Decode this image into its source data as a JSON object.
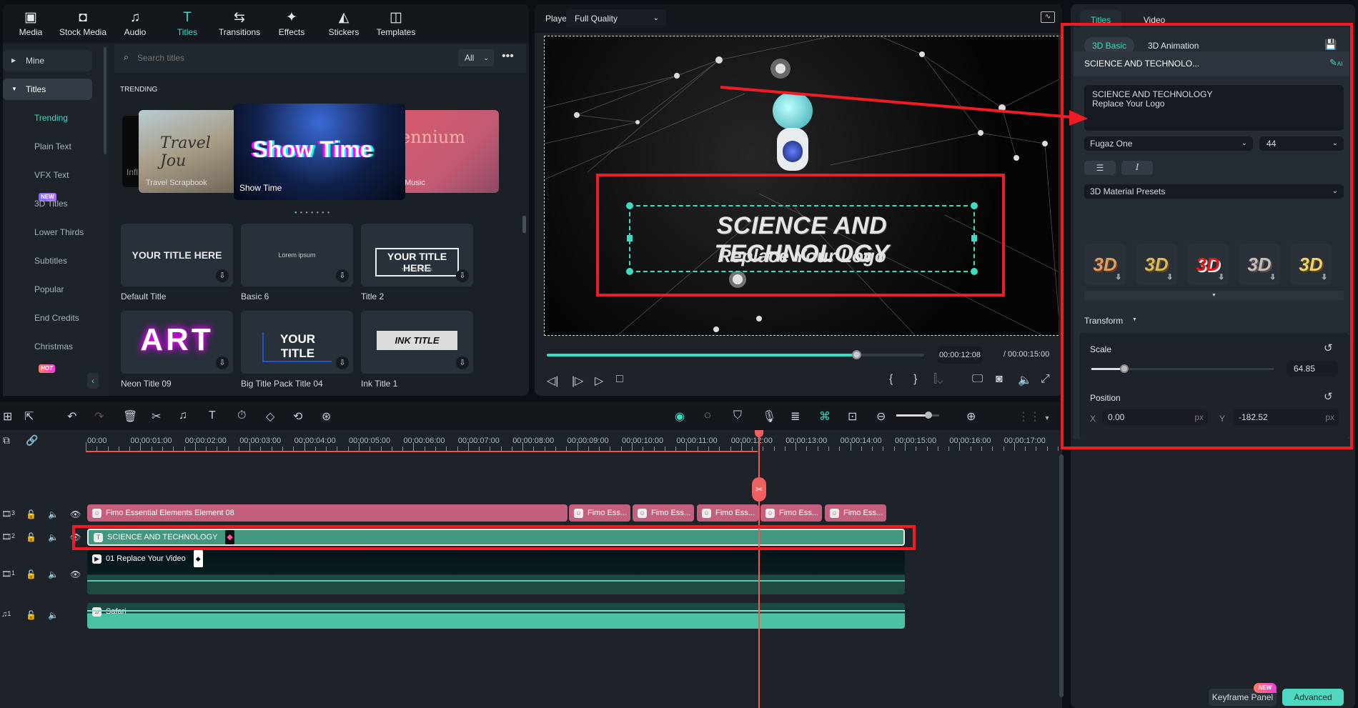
{
  "toolbar": {
    "items": [
      {
        "label": "Media",
        "icon": "media-icon"
      },
      {
        "label": "Stock Media",
        "icon": "stock-media-icon"
      },
      {
        "label": "Audio",
        "icon": "music-note-icon"
      },
      {
        "label": "Titles",
        "icon": "titles-icon"
      },
      {
        "label": "Transitions",
        "icon": "transitions-icon"
      },
      {
        "label": "Effects",
        "icon": "effects-icon"
      },
      {
        "label": "Stickers",
        "icon": "stickers-icon"
      },
      {
        "label": "Templates",
        "icon": "templates-icon"
      }
    ],
    "active": "Titles"
  },
  "sidebar": {
    "mine": "Mine",
    "titles": "Titles",
    "items": [
      "Trending",
      "Plain Text",
      "VFX Text",
      "3D Titles",
      "Lower Thirds",
      "Subtitles",
      "Popular",
      "End Credits",
      "Christmas"
    ],
    "badge_new": "NEW",
    "badge_hot": "HOT"
  },
  "library": {
    "search_placeholder": "Search titles",
    "filter": "All",
    "section": "TRENDING",
    "carousel": {
      "left": "Travel Scrapbook",
      "center": "Show Time",
      "center_art": "Show Time",
      "right": "Music",
      "right_art": "ennium",
      "left_art": "Travel Jou",
      "far_left": "Infl"
    },
    "cards": [
      {
        "label": "Default Title",
        "art": "YOUR TITLE HERE"
      },
      {
        "label": "Basic 6",
        "art": "Lorem ipsum"
      },
      {
        "label": "Title 2",
        "art": "YOUR TITLE HERE",
        "sub": "YOUR TEXT HERE"
      },
      {
        "label": "Neon Title 09",
        "art": "ART"
      },
      {
        "label": "Big Title Pack Title 04",
        "art": "YOUR TITLE"
      },
      {
        "label": "Ink Title 1",
        "art": "INK TITLE"
      }
    ]
  },
  "player": {
    "label": "Player",
    "quality": "Full Quality",
    "title_line1": "SCIENCE AND TECHNOLOGY",
    "title_line2": "Replace Your Logo",
    "current_time": "00:00:12:08",
    "total_time": "/ 00:00:15:00",
    "progress": 0.82
  },
  "timeline": {
    "ruler": [
      "00:00",
      "00:00:01:00",
      "00:00:02:00",
      "00:00:03:00",
      "00:00:04:00",
      "00:00:05:00",
      "00:00:06:00",
      "00:00:07:00",
      "00:00:08:00",
      "00:00:09:00",
      "00:00:10:00",
      "00:00:11:00",
      "00:00:12:00",
      "00:00:13:00",
      "00:00:14:00",
      "00:00:15:00",
      "00:00:16:00",
      "00:00:17:00"
    ],
    "tracks": {
      "v3": {
        "num": "3",
        "clips": [
          "Fimo Essential Elements Element 08",
          "Fimo Ess...",
          "Fimo Ess...",
          "Fimo Ess...",
          "Fimo Ess...",
          "Fimo Ess..."
        ]
      },
      "v2": {
        "num": "2",
        "clip": "SCIENCE AND TECHNOLOGY"
      },
      "v1": {
        "num": "1",
        "clip": "01 Replace Your Video"
      },
      "a1": {
        "num": "1",
        "clip": "Safari"
      }
    },
    "zoom_level": 0.75
  },
  "right_panel": {
    "tabs": [
      "Titles",
      "Video"
    ],
    "subtabs": [
      "3D Basic",
      "3D Animation"
    ],
    "clip_title": "SCIENCE AND TECHNOLO...",
    "ai_label": "AI",
    "text_value": "SCIENCE AND TECHNOLOGY\nReplace Your Logo",
    "font": "Fugaz One",
    "font_size": "44",
    "presets_label": "3D Material Presets",
    "preset_text": "3D",
    "transform": "Transform",
    "scale_label": "Scale",
    "scale_value": "64.85",
    "position_label": "Position",
    "x_label": "X",
    "x_value": "0.00",
    "y_label": "Y",
    "y_value": "-182.52",
    "unit": "px",
    "keyframe": "Keyframe Panel",
    "keyframe_badge": "NEW",
    "advanced": "Advanced"
  },
  "colors": {
    "accent": "#3ddbc2",
    "annotation": "#ee1c25",
    "title_clip": "#43967f",
    "effect_clip": "#c2607e"
  }
}
